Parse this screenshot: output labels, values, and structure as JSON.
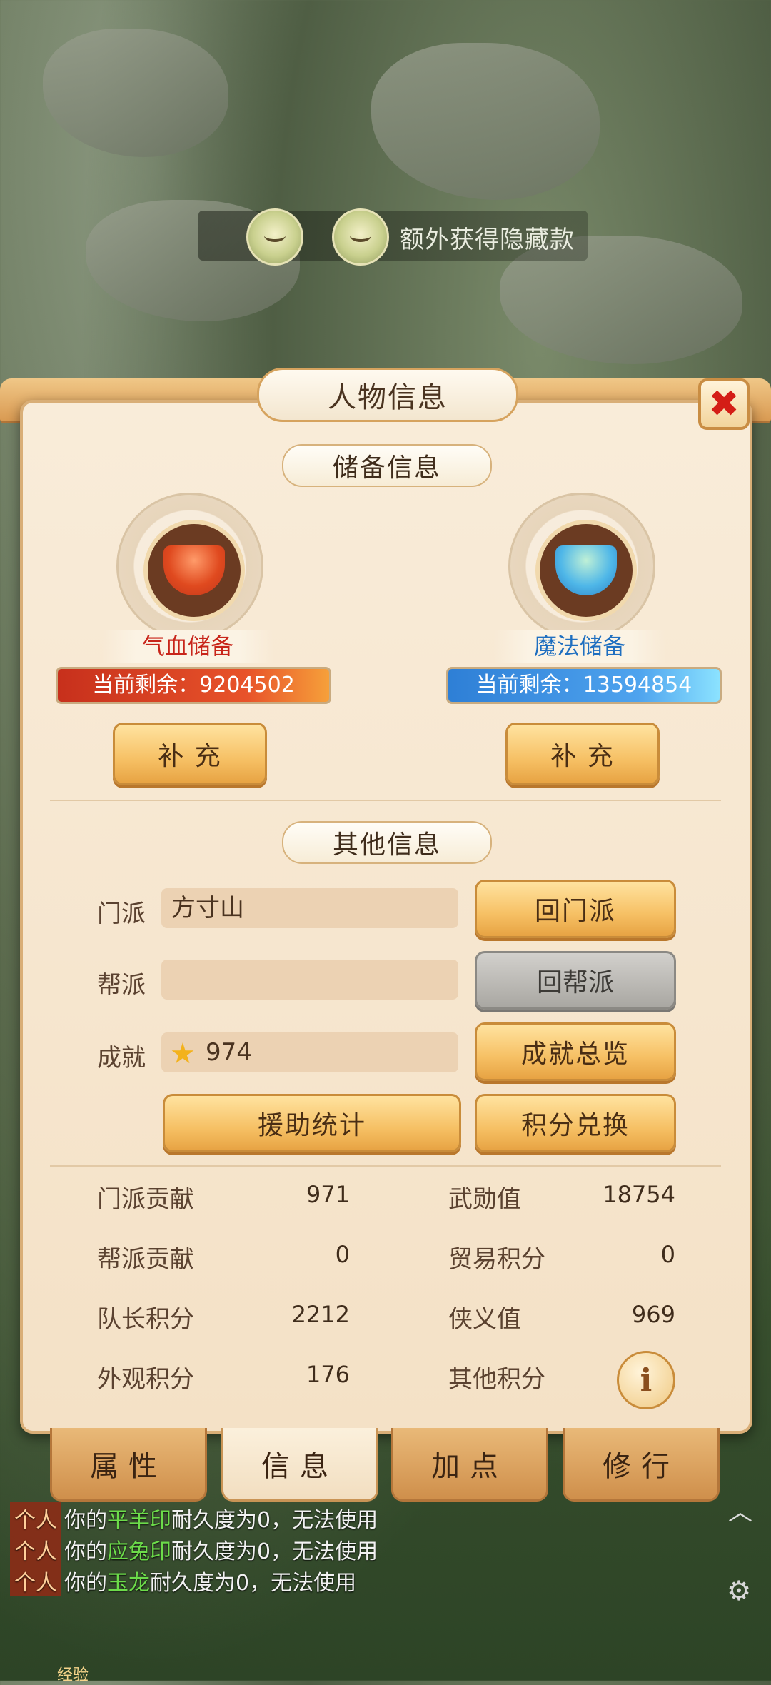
{
  "banner": {
    "text": "额外获得隐藏款"
  },
  "panel": {
    "title": "人物信息",
    "close": "✖",
    "reserve_title": "储备信息",
    "hp": {
      "label": "气血储备",
      "remaining": "当前剩余：9204502",
      "button": "补 充"
    },
    "mp": {
      "label": "魔法储备",
      "remaining": "当前剩余：13594854",
      "button": "补 充"
    },
    "other_title": "其他信息",
    "sect": {
      "label": "门派",
      "value": "方寸山",
      "button": "回门派"
    },
    "guild": {
      "label": "帮派",
      "value": "",
      "button": "回帮派"
    },
    "achievement": {
      "label": "成就",
      "value": "974",
      "button": "成就总览"
    },
    "aid_button": "援助统计",
    "points_button": "积分兑换",
    "stats": [
      {
        "label": "门派贡献",
        "value": "971"
      },
      {
        "label": "武勋值",
        "value": "18754"
      },
      {
        "label": "帮派贡献",
        "value": "0"
      },
      {
        "label": "贸易积分",
        "value": "0"
      },
      {
        "label": "队长积分",
        "value": "2212"
      },
      {
        "label": "侠义值",
        "value": "969"
      },
      {
        "label": "外观积分",
        "value": "176"
      },
      {
        "label": "其他积分",
        "value": ""
      }
    ],
    "info_icon": "i"
  },
  "tabs": [
    "属性",
    "信息",
    "加点",
    "修行"
  ],
  "chat": [
    {
      "tag": "个人",
      "pre": "你的",
      "item": "平羊印",
      "post": "耐久度为0，无法使用"
    },
    {
      "tag": "个人",
      "pre": "你的",
      "item": "应兔印",
      "post": "耐久度为0，无法使用"
    },
    {
      "tag": "个人",
      "pre": "你的",
      "item": "玉龙",
      "post": "耐久度为0，无法使用"
    }
  ],
  "exp_label": "经验",
  "icons": [
    "close-icon",
    "star-icon",
    "info-icon",
    "gear-icon",
    "chevron-up-icon"
  ]
}
